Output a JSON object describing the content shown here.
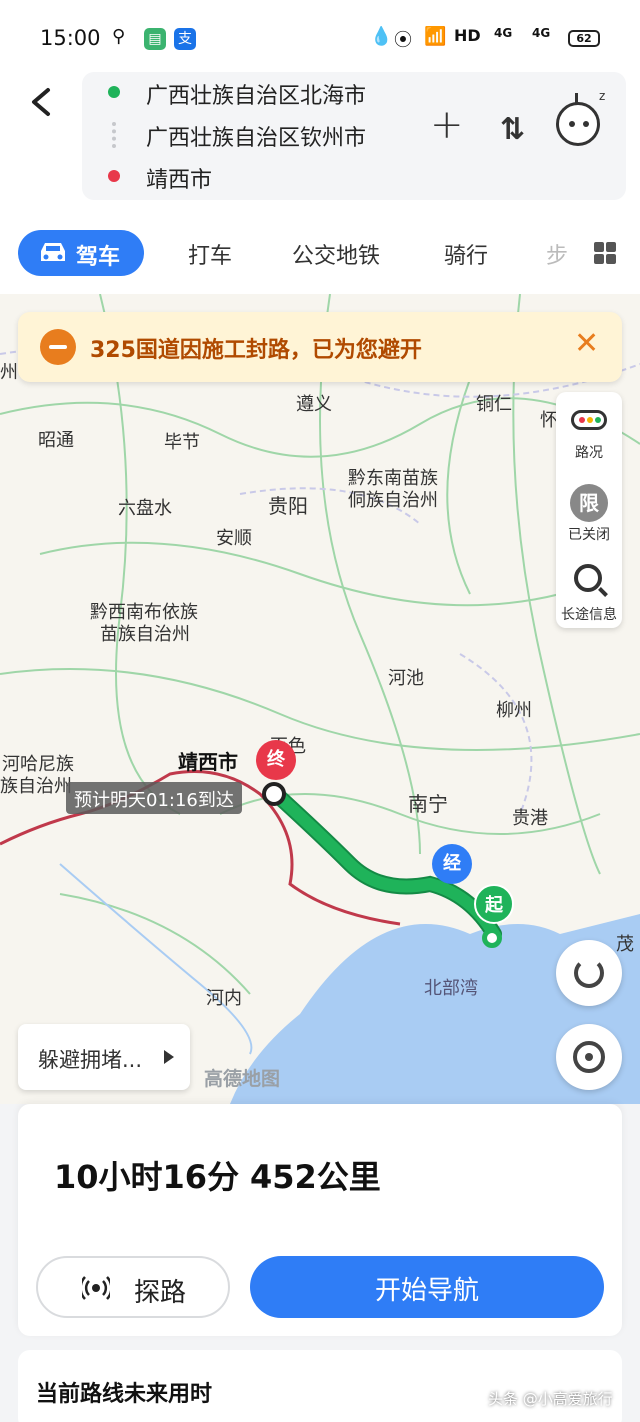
{
  "status_bar": {
    "time": "15:00",
    "right": "HD",
    "net1": "4G",
    "net2": "4G",
    "battery": "62"
  },
  "route": {
    "origin": "广西壮族自治区北海市",
    "waypoint": "广西壮族自治区钦州市",
    "destination": "靖西市"
  },
  "tabs": {
    "active": "驾车",
    "items": [
      "打车",
      "公交地铁",
      "骑行",
      "步"
    ]
  },
  "notice": {
    "text": "325国道因施工封路，已为您避开"
  },
  "side_panel": {
    "traffic": "路况",
    "limit_icon": "限",
    "limit": "已关闭",
    "info": "长途信息"
  },
  "map": {
    "labels": [
      "遵义",
      "铜仁",
      "昭通",
      "毕节",
      "贵阳",
      "黔东南苗族",
      "侗族自治州",
      "六盘水",
      "安顺",
      "黔西南布依族",
      "苗族自治州",
      "河池",
      "柳州",
      "百色",
      "南宁",
      "贵港",
      "河哈尼族",
      "族自治州",
      "河内",
      "北部湾",
      "茂",
      "州",
      "怀"
    ],
    "dest_label": "靖西市",
    "eta": "预计明天01:16到达",
    "pin_end": "终",
    "pin_via": "经",
    "pin_start": "起",
    "avoid": "躲避拥堵...",
    "watermark": "高德地图"
  },
  "summary": {
    "time": "10小时16分",
    "distance": "452公里",
    "probe": "探路",
    "navigate": "开始导航"
  },
  "future": {
    "title": "当前路线未来用时"
  },
  "source_watermark": "头条 @小高爱旅行",
  "colors": {
    "accent": "#2f7df6",
    "route": "#1fb35a",
    "notice_bg": "#fff4d6",
    "notice_text": "#b04a00",
    "dest_pin": "#e8384a",
    "start_pin": "#1fb35a"
  }
}
